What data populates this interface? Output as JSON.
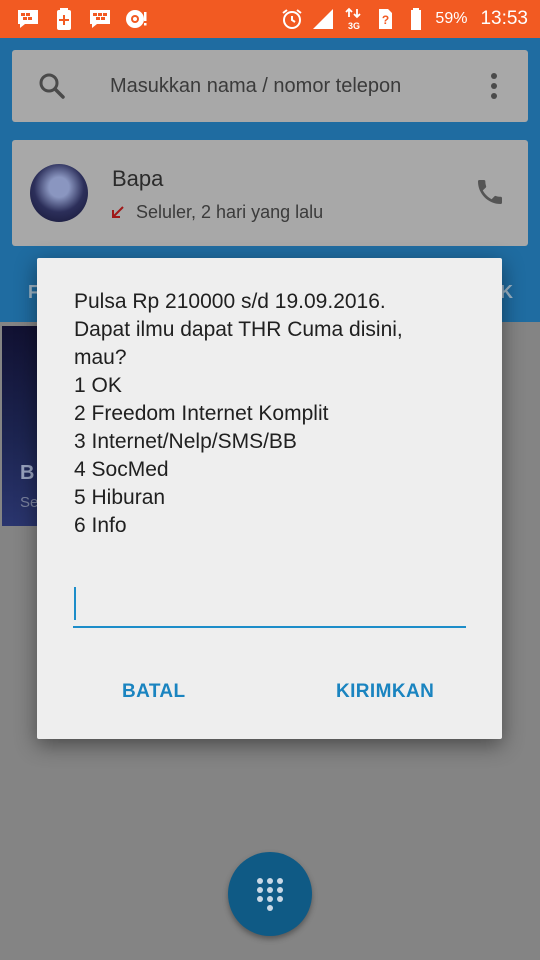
{
  "status_bar": {
    "battery_percent": "59%",
    "time": "13:53",
    "network_type": "3G",
    "left_icons": [
      "bbm-notification-icon",
      "battery-saver-icon",
      "bbm-chat-icon",
      "camera-app-icon"
    ],
    "right_icons": [
      "alarm-icon",
      "signal-icon",
      "3g-data-icon",
      "sim-unknown-icon",
      "battery-icon"
    ]
  },
  "search": {
    "placeholder": "Masukkan nama / nomor telepon"
  },
  "recent_call": {
    "name": "Bapa",
    "detail": "Seluler, 2 hari yang lalu"
  },
  "tabs": {
    "left_partial": "F",
    "right_partial": "K"
  },
  "thumbnail": {
    "title_partial": "B",
    "subtitle_partial": "Se"
  },
  "dialog": {
    "lines": [
      "Pulsa Rp 210000 s/d 19.09.2016.",
      "Dapat ilmu dapat THR Cuma disini,",
      "mau?",
      "1 OK",
      "2 Freedom Internet Komplit",
      "3 Internet/Nelp/SMS/BB",
      "4 SocMed",
      "5 Hiburan",
      "6 Info"
    ],
    "input_value": "",
    "cancel_label": "BATAL",
    "send_label": "KIRIMKAN"
  },
  "colors": {
    "status_bar": "#f25a22",
    "app_header_dimmed": "#1f6ca1",
    "accent": "#1a84c0",
    "dialog_bg": "#eeeeee",
    "fab": "#0f5a85"
  }
}
